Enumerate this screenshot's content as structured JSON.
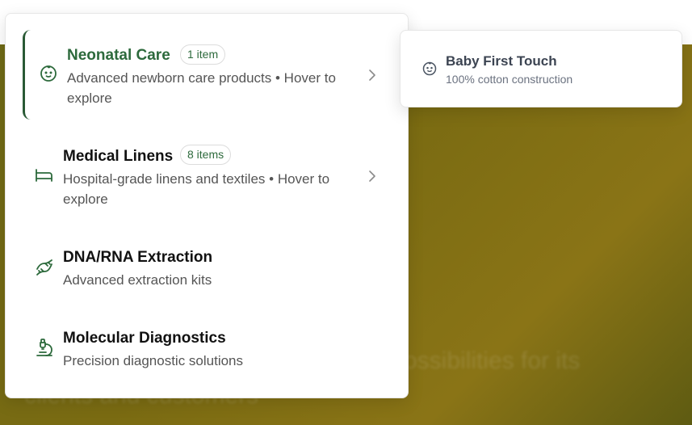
{
  "hero": {
    "ghost_line_1": "ossibilities for its",
    "ghost_line_2": "clients and customers"
  },
  "menu": {
    "items": [
      {
        "title": "Neonatal Care",
        "badge": "1 item",
        "desc": "Advanced newborn care products • Hover to explore",
        "icon": "baby-face-icon",
        "has_submenu": true,
        "active": true
      },
      {
        "title": "Medical Linens",
        "badge": "8 items",
        "desc": "Hospital-grade linens and textiles • Hover to explore",
        "icon": "bed-icon",
        "has_submenu": true,
        "active": false
      },
      {
        "title": "DNA/RNA Extraction",
        "desc": "Advanced extraction kits",
        "icon": "dna-icon",
        "has_submenu": false,
        "active": false
      },
      {
        "title": "Molecular Diagnostics",
        "desc": "Precision diagnostic solutions",
        "icon": "microscope-icon",
        "has_submenu": false,
        "active": false
      }
    ]
  },
  "submenu": {
    "items": [
      {
        "title": "Baby First Touch",
        "desc": "100% cotton construction",
        "icon": "baby-face-icon"
      }
    ]
  },
  "colors": {
    "accent_green": "#2d6a3c",
    "hero_olive": "#7a6b12"
  }
}
